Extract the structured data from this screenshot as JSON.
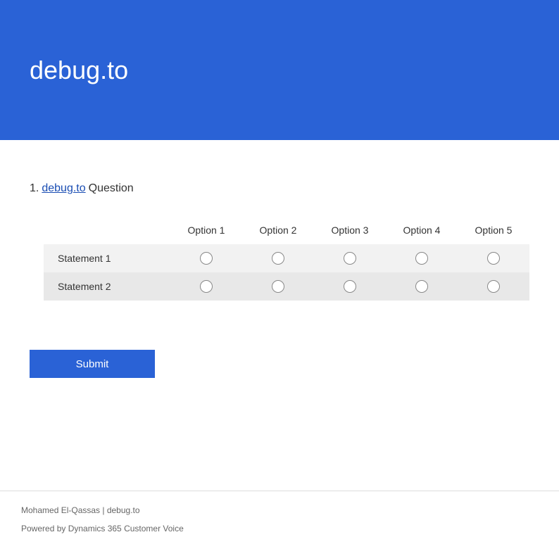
{
  "header": {
    "title": "debug.to"
  },
  "question": {
    "number": "1.",
    "link_text": "debug.to",
    "text": "Question",
    "options": [
      "Option 1",
      "Option 2",
      "Option 3",
      "Option 4",
      "Option 5"
    ],
    "statements": [
      "Statement 1",
      "Statement 2"
    ]
  },
  "submit": {
    "label": "Submit"
  },
  "footer": {
    "line1": "Mohamed El-Qassas | debug.to",
    "line2_prefix": "Powered by ",
    "line2_link": "Dynamics 365 Customer Voice"
  }
}
